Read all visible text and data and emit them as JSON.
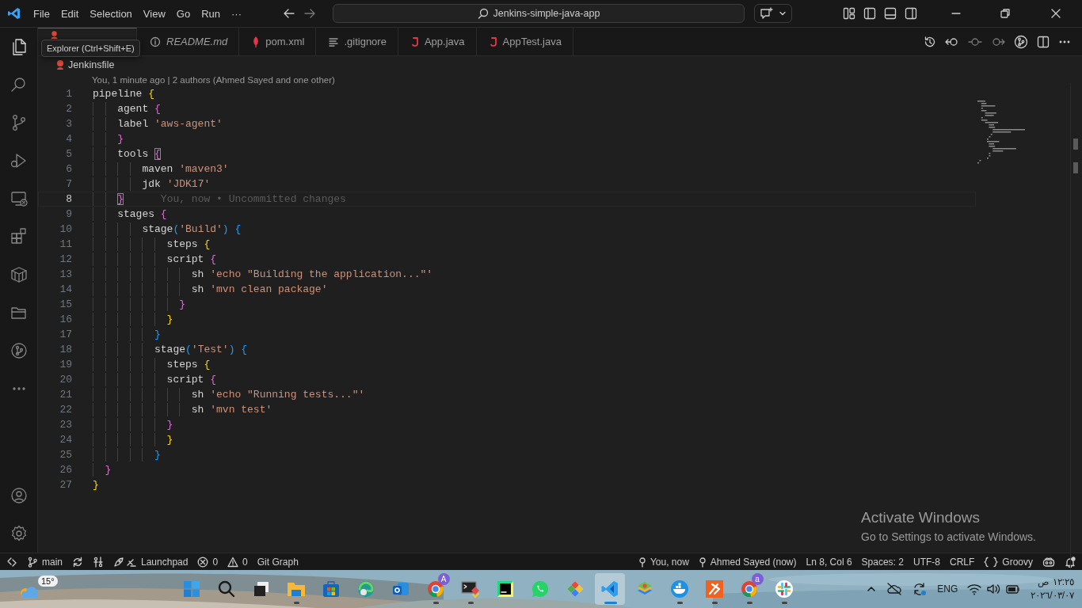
{
  "title_bar": {
    "menu": [
      "File",
      "Edit",
      "Selection",
      "View",
      "Go",
      "Run",
      "···"
    ],
    "command_center": "Jenkins-simple-java-app"
  },
  "tooltip": "Explorer (Ctrl+Shift+E)",
  "tabs": [
    {
      "kind": "jenkins",
      "selected": true
    },
    {
      "kind": "info",
      "label": "README.md",
      "selected": false,
      "preview": true
    },
    {
      "kind": "maven",
      "label": "pom.xml",
      "selected": false,
      "preview": false
    },
    {
      "kind": "lines",
      "label": ".gitignore",
      "selected": false,
      "preview": false
    },
    {
      "kind": "java",
      "label": "App.java",
      "selected": false,
      "preview": false
    },
    {
      "kind": "java",
      "label": "AppTest.java",
      "selected": false,
      "preview": false
    }
  ],
  "breadcrumb": "Jenkinsfile",
  "blame_header": "You, 1 minute ago | 2 authors (Ahmed Sayed and one other)",
  "code": [
    {
      "n": "1",
      "current": false,
      "tokens": [
        {
          "t": "pipeline ",
          "kind": "plain"
        },
        {
          "t": "{",
          "kind": "gold"
        }
      ]
    },
    {
      "n": "2",
      "current": false,
      "tokens": [
        {
          "t": "    agent ",
          "kind": "plain"
        },
        {
          "t": "{",
          "kind": "pink"
        }
      ]
    },
    {
      "n": "3",
      "current": false,
      "tokens": [
        {
          "t": "    label ",
          "kind": "plain"
        },
        {
          "t": "'aws-agent'",
          "kind": "string"
        }
      ]
    },
    {
      "n": "4",
      "current": false,
      "tokens": [
        {
          "t": "    }",
          "kind": "pink"
        }
      ]
    },
    {
      "n": "5",
      "current": false,
      "tokens": [
        {
          "t": "    tools ",
          "kind": "plain"
        },
        {
          "t": "{",
          "kind": "pink",
          "match": true
        }
      ]
    },
    {
      "n": "6",
      "current": false,
      "tokens": [
        {
          "t": "        maven ",
          "kind": "plain"
        },
        {
          "t": "'maven3'",
          "kind": "string"
        }
      ]
    },
    {
      "n": "7",
      "current": false,
      "tokens": [
        {
          "t": "        jdk ",
          "kind": "plain"
        },
        {
          "t": "'JDK17'",
          "kind": "string"
        }
      ]
    },
    {
      "n": "8",
      "current": true,
      "blame": "You, now • Uncommitted changes",
      "tokens": [
        {
          "t": "    }",
          "kind": "pink",
          "match": true
        }
      ]
    },
    {
      "n": "9",
      "current": false,
      "tokens": [
        {
          "t": "    stages ",
          "kind": "plain"
        },
        {
          "t": "{",
          "kind": "pink"
        }
      ]
    },
    {
      "n": "10",
      "current": false,
      "tokens": [
        {
          "t": "        stage",
          "kind": "plain"
        },
        {
          "t": "(",
          "kind": "blue"
        },
        {
          "t": "'Build'",
          "kind": "string"
        },
        {
          "t": ")",
          "kind": "blue"
        },
        {
          "t": " {",
          "kind": "blue"
        }
      ]
    },
    {
      "n": "11",
      "current": false,
      "tokens": [
        {
          "t": "            steps ",
          "kind": "plain"
        },
        {
          "t": "{",
          "kind": "gold"
        }
      ]
    },
    {
      "n": "12",
      "current": false,
      "tokens": [
        {
          "t": "            script ",
          "kind": "plain"
        },
        {
          "t": "{",
          "kind": "pink"
        }
      ]
    },
    {
      "n": "13",
      "current": false,
      "tokens": [
        {
          "t": "                sh ",
          "kind": "plain"
        },
        {
          "t": "'echo \"Building the application...\"'",
          "kind": "string"
        }
      ]
    },
    {
      "n": "14",
      "current": false,
      "tokens": [
        {
          "t": "                sh ",
          "kind": "plain"
        },
        {
          "t": "'mvn clean package'",
          "kind": "string"
        }
      ]
    },
    {
      "n": "15",
      "current": false,
      "tokens": [
        {
          "t": "              }",
          "kind": "pink"
        }
      ]
    },
    {
      "n": "16",
      "current": false,
      "tokens": [
        {
          "t": "            }",
          "kind": "gold"
        }
      ]
    },
    {
      "n": "17",
      "current": false,
      "tokens": [
        {
          "t": "          }",
          "kind": "blue"
        }
      ]
    },
    {
      "n": "18",
      "current": false,
      "tokens": [
        {
          "t": "          stage",
          "kind": "plain"
        },
        {
          "t": "(",
          "kind": "blue"
        },
        {
          "t": "'Test'",
          "kind": "string"
        },
        {
          "t": ")",
          "kind": "blue"
        },
        {
          "t": " {",
          "kind": "blue"
        }
      ]
    },
    {
      "n": "19",
      "current": false,
      "tokens": [
        {
          "t": "            steps ",
          "kind": "plain"
        },
        {
          "t": "{",
          "kind": "gold"
        }
      ]
    },
    {
      "n": "20",
      "current": false,
      "tokens": [
        {
          "t": "            script ",
          "kind": "plain"
        },
        {
          "t": "{",
          "kind": "pink"
        }
      ]
    },
    {
      "n": "21",
      "current": false,
      "tokens": [
        {
          "t": "                sh ",
          "kind": "plain"
        },
        {
          "t": "'echo \"Running tests...\"'",
          "kind": "string"
        }
      ]
    },
    {
      "n": "22",
      "current": false,
      "tokens": [
        {
          "t": "                sh ",
          "kind": "plain"
        },
        {
          "t": "'mvn test'",
          "kind": "string"
        }
      ]
    },
    {
      "n": "23",
      "current": false,
      "tokens": [
        {
          "t": "            }",
          "kind": "pink"
        }
      ]
    },
    {
      "n": "24",
      "current": false,
      "tokens": [
        {
          "t": "            }",
          "kind": "gold"
        }
      ]
    },
    {
      "n": "25",
      "current": false,
      "tokens": [
        {
          "t": "          }",
          "kind": "blue"
        }
      ]
    },
    {
      "n": "26",
      "current": false,
      "tokens": [
        {
          "t": "  }",
          "kind": "pink"
        }
      ]
    },
    {
      "n": "27",
      "current": false,
      "tokens": [
        {
          "t": "}",
          "kind": "gold"
        }
      ]
    }
  ],
  "activation_notice": {
    "title": "Activate Windows",
    "subtitle": "Go to Settings to activate Windows."
  },
  "status_bar": {
    "left": [
      {
        "kind": "remote"
      },
      {
        "kind": "branch",
        "label": "main"
      },
      {
        "kind": "sync"
      },
      {
        "kind": "git-tool"
      },
      {
        "kind": "launchpad",
        "label": "Launchpad"
      },
      {
        "kind": "errors",
        "label": "0"
      },
      {
        "kind": "warnings",
        "label": "0"
      },
      {
        "kind": "text",
        "label": "Git Graph"
      }
    ],
    "right": [
      {
        "kind": "commit",
        "label": "You, now"
      },
      {
        "kind": "commit",
        "label": "Ahmed Sayed (now)"
      },
      {
        "kind": "text",
        "label": "Ln 8, Col 6"
      },
      {
        "kind": "text",
        "label": "Spaces: 2"
      },
      {
        "kind": "text",
        "label": "UTF-8"
      },
      {
        "kind": "text",
        "label": "CRLF"
      },
      {
        "kind": "language",
        "label": "Groovy"
      },
      {
        "kind": "copilot"
      },
      {
        "kind": "bell"
      }
    ]
  },
  "taskbar": {
    "weather": "15°",
    "apps": [
      {
        "kind": "start",
        "running": false,
        "selected": false
      },
      {
        "kind": "search",
        "running": false,
        "selected": false
      },
      {
        "kind": "taskview",
        "running": false,
        "selected": false
      },
      {
        "kind": "folder",
        "running": true,
        "selected": false
      },
      {
        "kind": "store",
        "running": false,
        "selected": false
      },
      {
        "kind": "edge",
        "running": false,
        "selected": false
      },
      {
        "kind": "mail",
        "running": false,
        "selected": false
      },
      {
        "kind": "chrome",
        "running": true,
        "selected": false,
        "badge": "A"
      },
      {
        "kind": "terminal",
        "running": true,
        "selected": false
      },
      {
        "kind": "ide",
        "running": false,
        "selected": false
      },
      {
        "kind": "chat",
        "running": false,
        "selected": false
      },
      {
        "kind": "diamond",
        "running": false,
        "selected": false
      },
      {
        "kind": "vscode",
        "running": true,
        "selected": true
      },
      {
        "kind": "stack",
        "running": false,
        "selected": false
      },
      {
        "kind": "whale",
        "running": true,
        "selected": false
      },
      {
        "kind": "orange",
        "running": true,
        "selected": false
      },
      {
        "kind": "chrome",
        "running": true,
        "selected": false,
        "badge": "a"
      },
      {
        "kind": "slack",
        "running": true,
        "selected": false
      }
    ],
    "tray": {
      "language": "ENG",
      "time": "١٢:٢٥ ص",
      "date": "٢٠٢٦/٠٣/٠٧"
    }
  }
}
